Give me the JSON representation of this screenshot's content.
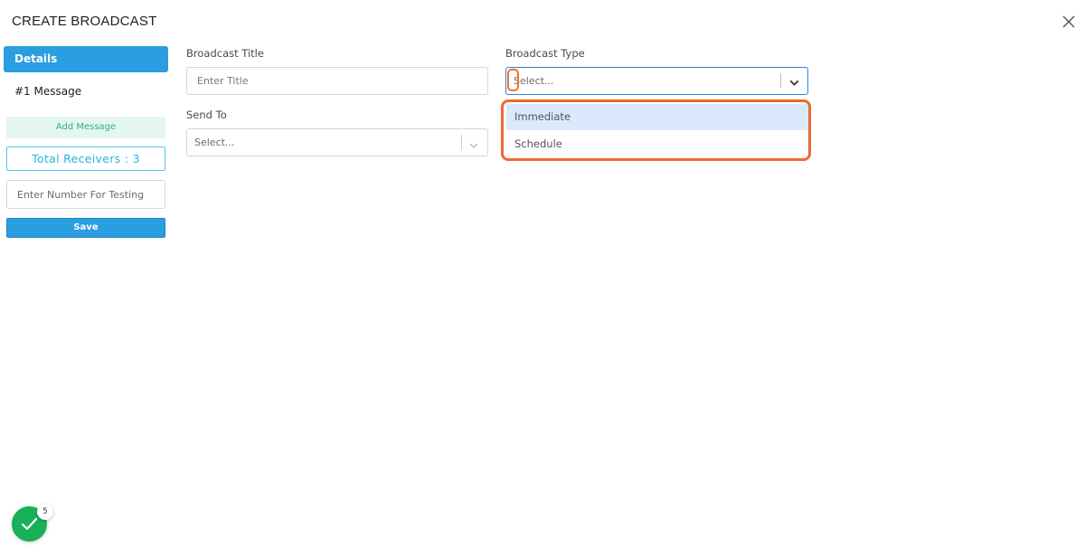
{
  "modal": {
    "title": "CREATE BROADCAST",
    "close_icon": "close-icon"
  },
  "sidebar": {
    "items": [
      {
        "label": "Details",
        "active": true
      },
      {
        "label": "#1 Message",
        "active": false
      }
    ],
    "add_message_label": "Add Message",
    "total_receivers_label": "Total Receivers : 3",
    "test_number_placeholder": "Enter Number For Testing",
    "save_label": "Save"
  },
  "form": {
    "title_label": "Broadcast Title",
    "title_placeholder": "Enter Title",
    "type_label": "Broadcast Type",
    "type_placeholder": "Select...",
    "send_to_label": "Send To",
    "send_to_placeholder": "Select...",
    "type_options": [
      {
        "label": "Immediate",
        "highlighted": true
      },
      {
        "label": "Schedule",
        "highlighted": false
      }
    ]
  },
  "status": {
    "count": "5",
    "icon": "check-icon"
  },
  "colors": {
    "primary": "#2a9ee0",
    "highlight_outline": "#ee6a30",
    "success": "#16b158",
    "teal_text": "#2bb18a",
    "cyan_border": "#52c6e6"
  }
}
